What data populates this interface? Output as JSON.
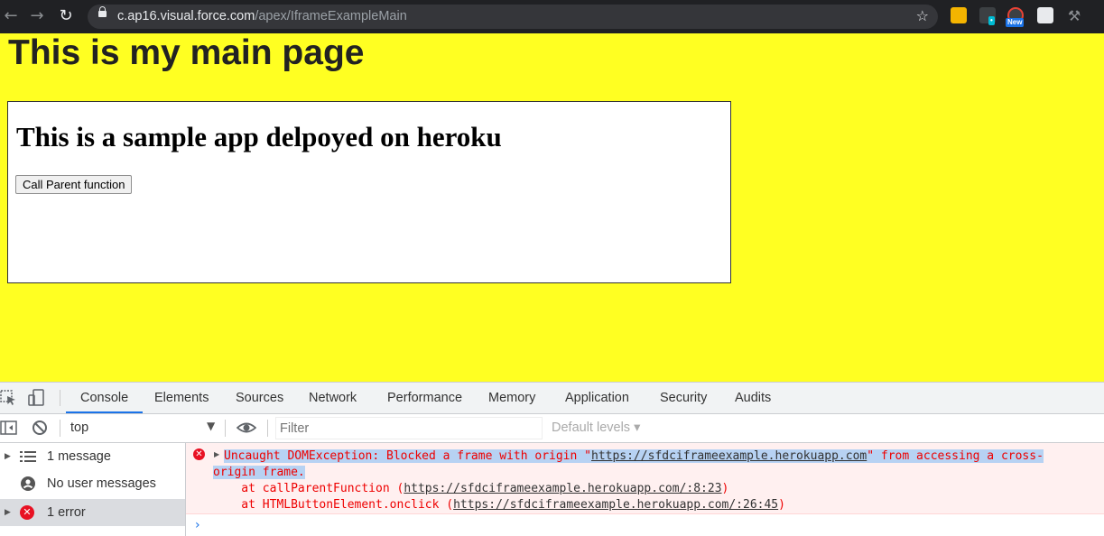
{
  "browser": {
    "url_host": "c.ap16.visual.force.com",
    "url_path": "/apex/IframeExampleMain",
    "ext_badge": "New"
  },
  "page": {
    "title": "This is my main page",
    "iframe_title": "This is a sample app delpoyed on heroku",
    "call_button": "Call Parent function"
  },
  "devtools": {
    "tabs": [
      "Console",
      "Elements",
      "Sources",
      "Network",
      "Performance",
      "Memory",
      "Application",
      "Security",
      "Audits"
    ],
    "context": "top",
    "filter_placeholder": "Filter",
    "levels": "Default levels ▾",
    "sidebar": [
      "1 message",
      "No user messages",
      "1 error"
    ],
    "error": {
      "l1a": "Uncaught DOMException: Blocked a frame with origin \"",
      "l1link": "https://sfdciframeexample.herokuapp.com",
      "l1b": "\" from accessing a cross-",
      "l2": "origin frame.",
      "l3a": "    at callParentFunction (",
      "l3link": "https://sfdciframeexample.herokuapp.com/:8:23",
      "l3b": ")",
      "l4a": "    at HTMLButtonElement.onclick (",
      "l4link": "https://sfdciframeexample.herokuapp.com/:26:45",
      "l4b": ")"
    }
  },
  "colors": {
    "page_bg": "#ffff22",
    "accent": "#1a73e8",
    "error": "#e81123"
  }
}
